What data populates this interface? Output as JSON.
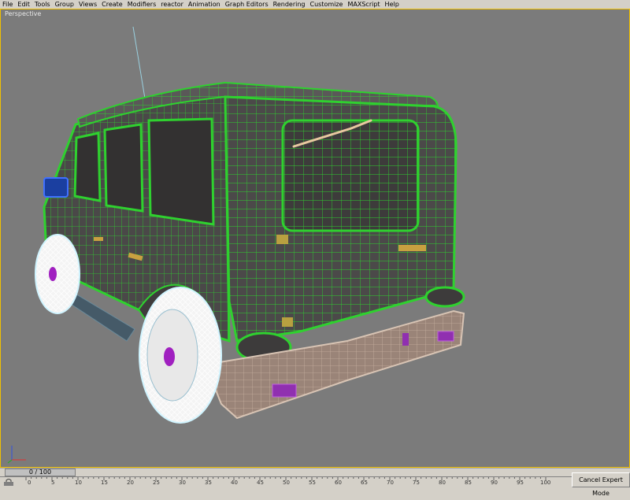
{
  "menu": {
    "items": [
      "File",
      "Edit",
      "Tools",
      "Group",
      "Views",
      "Create",
      "Modifiers",
      "reactor",
      "Animation",
      "Graph Editors",
      "Rendering",
      "Customize",
      "MAXScript",
      "Help"
    ]
  },
  "viewport": {
    "label": "Perspective",
    "background": "#7b7b7b",
    "active_border_color": "#f0c000",
    "wire_color": "#2fd12f"
  },
  "timeline": {
    "slider_text": "0 / 100",
    "ticks": [
      "0",
      "5",
      "10",
      "15",
      "20",
      "25",
      "30",
      "35",
      "40",
      "45",
      "50",
      "55",
      "60",
      "65",
      "70",
      "75",
      "80",
      "85",
      "90",
      "95",
      "100"
    ]
  },
  "expert_mode": {
    "label": "Cancel Expert Mode"
  },
  "icons": {
    "axis": "axis-tripod-icon",
    "lock": "lock-icon"
  }
}
